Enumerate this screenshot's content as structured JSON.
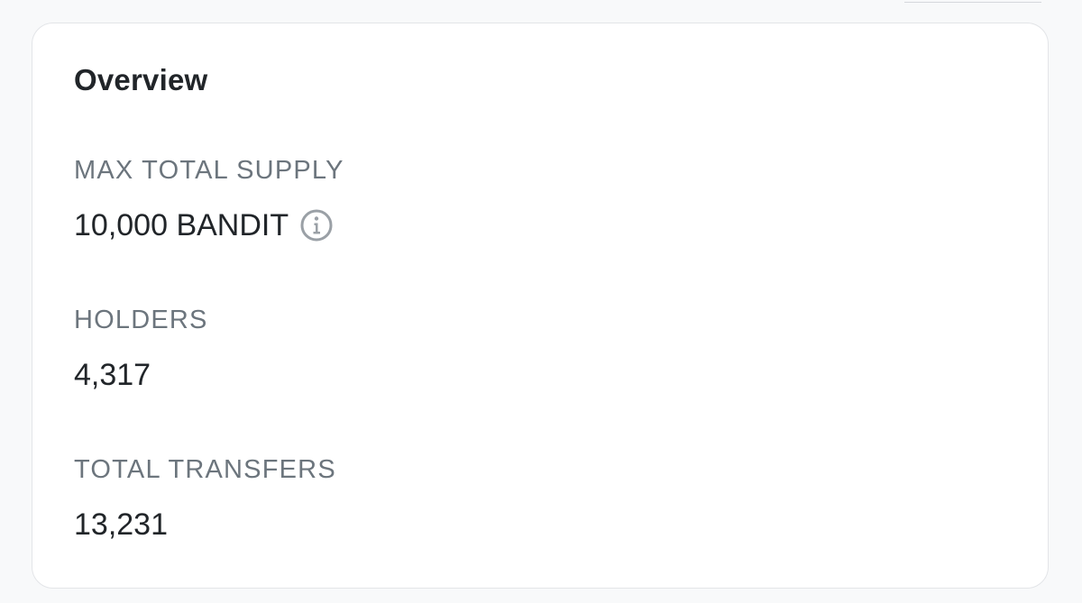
{
  "overview": {
    "title": "Overview",
    "stats": [
      {
        "label": "MAX TOTAL SUPPLY",
        "value": "10,000 BANDIT",
        "icon": "info-icon"
      },
      {
        "label": "HOLDERS",
        "value": "4,317"
      },
      {
        "label": "TOTAL TRANSFERS",
        "value": "13,231"
      }
    ]
  },
  "colors": {
    "page_background": "#f8f9fa",
    "card_background": "#ffffff",
    "card_border": "#e3e5e8",
    "label_text": "#6c757d",
    "value_text": "#212529",
    "icon": "#9aa0a6"
  }
}
